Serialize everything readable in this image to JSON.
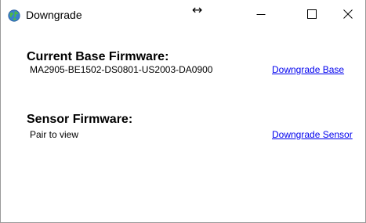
{
  "window": {
    "title": "Downgrade",
    "icon": "globe-icon",
    "resize_cursor": "↔",
    "controls": {
      "minimize": "minimize-icon",
      "maximize": "maximize-icon",
      "close": "close-icon"
    }
  },
  "base_firmware": {
    "heading": "Current Base Firmware:",
    "version": "MA2905-BE1502-DS0801-US2003-DA0900",
    "action_label": "Downgrade Base"
  },
  "sensor_firmware": {
    "heading": "Sensor Firmware:",
    "status": "Pair to view",
    "action_label": "Downgrade Sensor"
  },
  "colors": {
    "link": "#0000ee",
    "globe_green": "#3aa53a",
    "globe_blue": "#3a7fd0"
  }
}
